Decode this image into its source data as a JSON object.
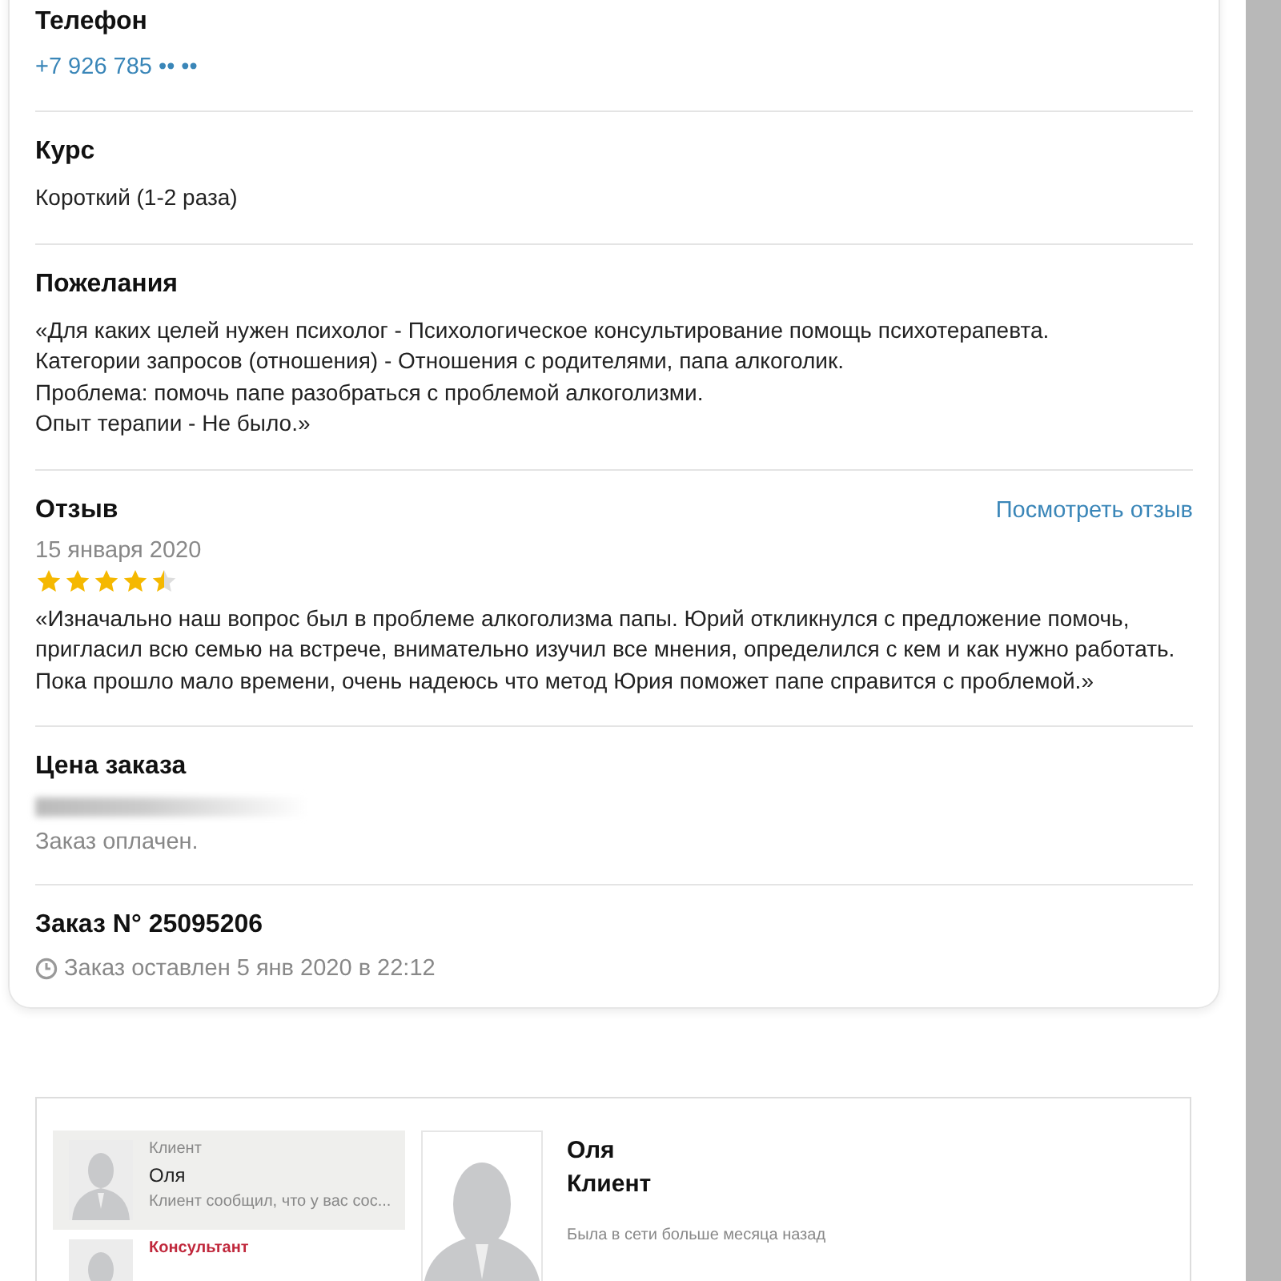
{
  "sections": [
    {
      "kind": "phone",
      "title": "Телефон",
      "value": "+7 926 785 •• ••"
    },
    {
      "kind": "text",
      "title": "Курс",
      "lines": [
        "Короткий (1-2 раза)"
      ]
    },
    {
      "kind": "text",
      "title": "Пожелания",
      "lines": [
        "«Для каких целей нужен психолог - Психологическое консультирование помощь психотерапевта.",
        "Категории запросов (отношения) - Отношения с родителями, папа алкоголик.",
        "Проблема: помочь папе разобраться с проблемой алкоголизми.",
        "Опыт терапии - Не было.»"
      ]
    },
    {
      "kind": "review",
      "title": "Отзыв",
      "link": "Посмотреть отзыв",
      "date": "15 января 2020",
      "stars": 4.5,
      "text": "«Изначально наш вопрос был в проблеме алкоголизма папы. Юрий откликнулся с предложение помочь, пригласил всю семью на встрече, внимательно изучил все мнения, определился с кем и как нужно работать. Пока прошло мало времени, очень надеюсь что метод Юрия поможет папе справится с проблемой.»"
    },
    {
      "kind": "price",
      "title": "Цена заказа",
      "note": "Заказ оплачен."
    },
    {
      "kind": "order",
      "title": "Заказ N° 25095206",
      "note": "Заказ оставлен 5 янв 2020 в 22:12"
    }
  ],
  "chat": {
    "items": [
      {
        "role": "Клиент",
        "name": "Оля",
        "preview": "Клиент сообщил, что у вас сос...",
        "selected": true,
        "kind": "client"
      },
      {
        "role": "Консультант",
        "selected": false,
        "kind": "consultant"
      }
    ],
    "profile": {
      "name": "Оля",
      "role": "Клиент",
      "status": "Была в сети больше месяца назад"
    }
  }
}
